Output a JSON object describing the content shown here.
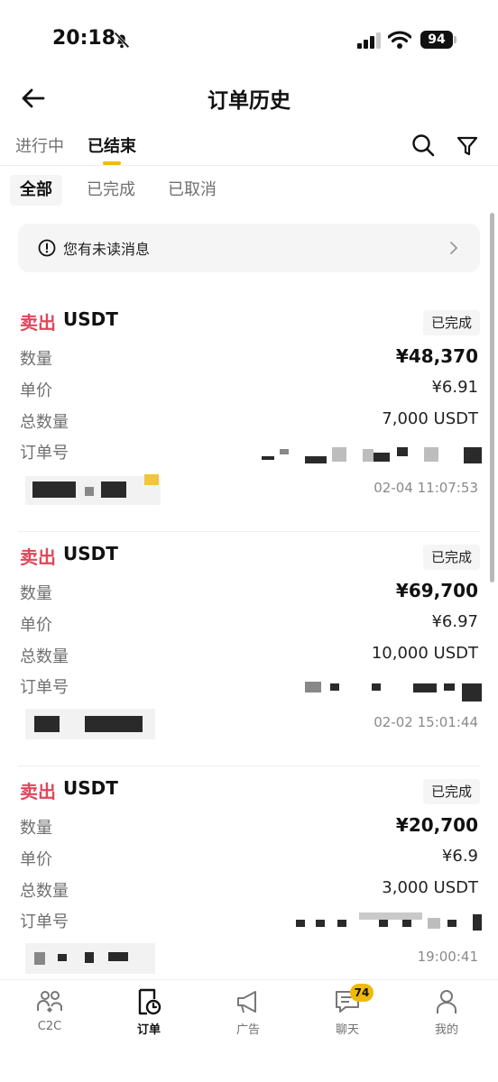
{
  "status_bar": {
    "time": "20:18",
    "battery": "94"
  },
  "header": {
    "title": "订单历史"
  },
  "main_tabs": [
    {
      "label": "进行中",
      "active": false
    },
    {
      "label": "已结束",
      "active": true
    }
  ],
  "sub_tabs": [
    {
      "label": "全部",
      "active": true
    },
    {
      "label": "已完成",
      "active": false
    },
    {
      "label": "已取消",
      "active": false
    }
  ],
  "notice": {
    "text": "您有未读消息"
  },
  "order_labels": {
    "amount": "数量",
    "price": "单价",
    "quantity": "总数量",
    "order_no": "订单号"
  },
  "orders": [
    {
      "side": "卖出",
      "asset": "USDT",
      "status": "已完成",
      "amount": "¥48,370",
      "price": "¥6.91",
      "quantity": "7,000 USDT",
      "time": "02-04 11:07:53"
    },
    {
      "side": "卖出",
      "asset": "USDT",
      "status": "已完成",
      "amount": "¥69,700",
      "price": "¥6.97",
      "quantity": "10,000 USDT",
      "time": "02-02 15:01:44"
    },
    {
      "side": "卖出",
      "asset": "USDT",
      "status": "已完成",
      "amount": "¥20,700",
      "price": "¥6.9",
      "quantity": "3,000 USDT",
      "time": "19:00:41"
    }
  ],
  "bottom_nav": [
    {
      "label": "C2C",
      "icon": "users-icon",
      "active": false
    },
    {
      "label": "订单",
      "icon": "order-icon",
      "active": true
    },
    {
      "label": "广告",
      "icon": "megaphone-icon",
      "active": false
    },
    {
      "label": "聊天",
      "icon": "chat-icon",
      "active": false,
      "badge": "74"
    },
    {
      "label": "我的",
      "icon": "profile-icon",
      "active": false
    }
  ],
  "colors": {
    "accent": "#f0b90b",
    "sell": "#e0475b"
  }
}
